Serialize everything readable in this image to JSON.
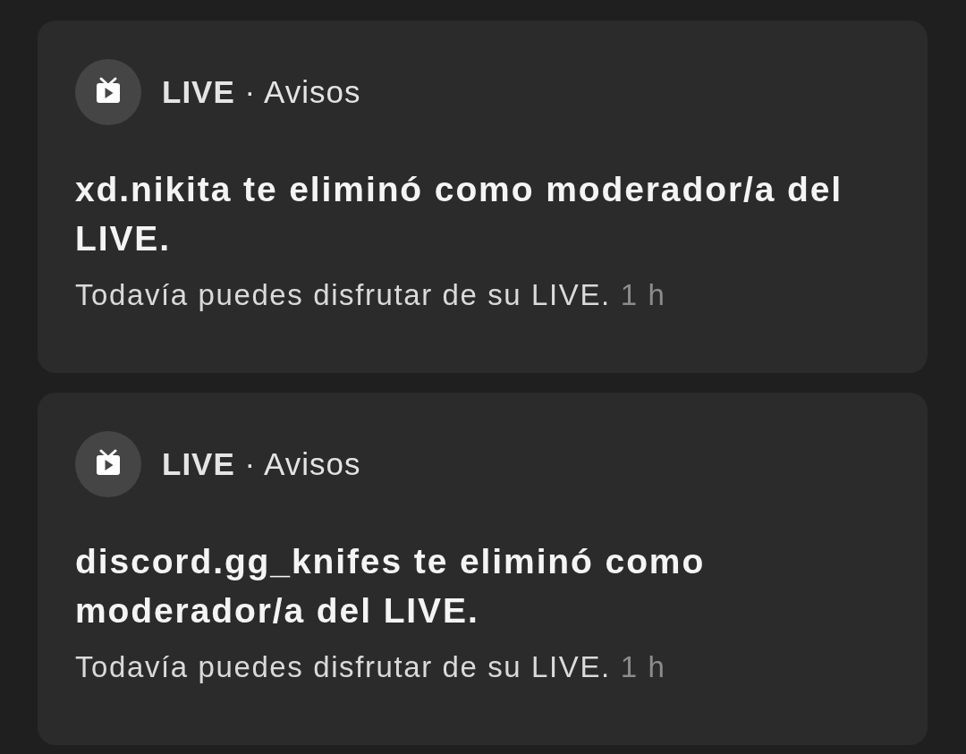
{
  "notifications": [
    {
      "source_line": "**LIVE** · Avisos",
      "title": "xd.nikita te eliminó como moderador/a del LIVE.",
      "message": "Todavía puedes disfrutar de su LIVE.",
      "time": "1 h"
    },
    {
      "source_line": "**LIVE** · Avisos",
      "title": "discord.gg_knifes te eliminó como moderador/a del LIVE.",
      "message": "Todavía puedes disfrutar de su LIVE.",
      "time": "1 h"
    }
  ]
}
